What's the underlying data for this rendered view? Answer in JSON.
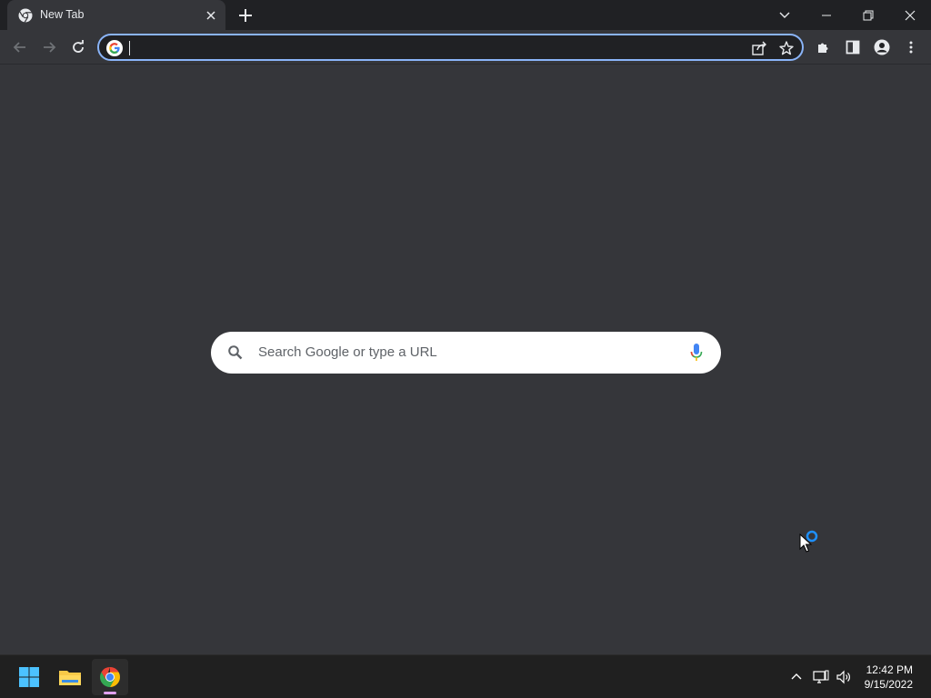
{
  "browser": {
    "tab": {
      "title": "New Tab"
    },
    "omnibox": {
      "value": "",
      "placeholder": ""
    }
  },
  "ntp": {
    "search_placeholder": "Search Google or type a URL"
  },
  "taskbar": {
    "time": "12:42 PM",
    "date": "9/15/2022"
  },
  "colors": {
    "accent": "#8ab4f8",
    "frame": "#202124",
    "toolbar": "#35363a"
  }
}
